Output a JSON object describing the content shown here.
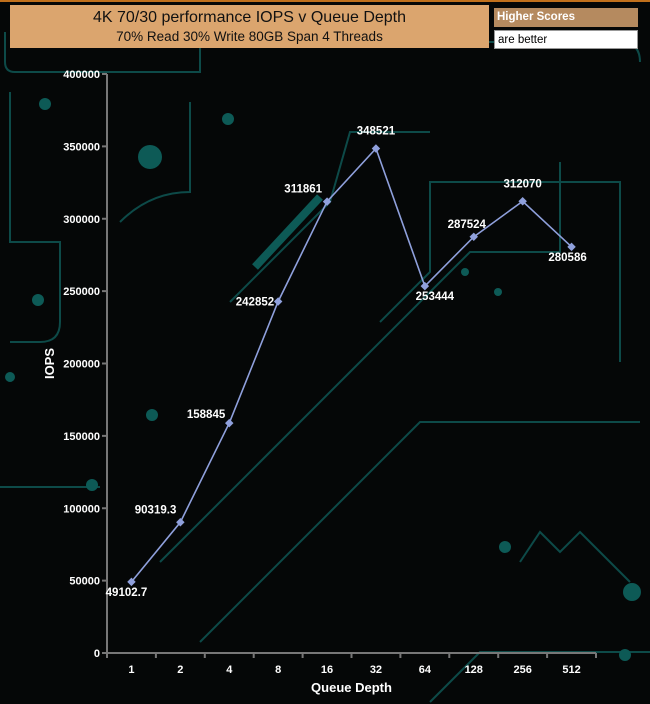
{
  "header": {
    "title": "4K 70/30 performance IOPS v Queue Depth",
    "subtitle": "70% Read 30% Write 80GB Span 4 Threads"
  },
  "note": {
    "line1": "Higher Scores",
    "line2": "are better"
  },
  "chart_data": {
    "type": "line",
    "title": "4K 70/30 performance IOPS v Queue Depth",
    "subtitle": "70% Read 30% Write 80GB Span 4 Threads",
    "xlabel": "Queue Depth",
    "ylabel": "IOPS",
    "categories": [
      "1",
      "2",
      "4",
      "8",
      "16",
      "32",
      "64",
      "128",
      "256",
      "512"
    ],
    "series": [
      {
        "name": "IOPS",
        "color": "#8fa0dc",
        "values": [
          49102.7,
          90319.3,
          158845,
          242852,
          311861,
          348521,
          253444,
          287524,
          312070,
          280586
        ],
        "labels": [
          "49102.7",
          "90319.3",
          "158845",
          "242852",
          "311861",
          "348521",
          "253444",
          "287524",
          "312070",
          "280586"
        ]
      }
    ],
    "ylim": [
      0,
      400000
    ],
    "yticks": [
      "0",
      "50000",
      "100000",
      "150000",
      "200000",
      "250000",
      "300000",
      "350000",
      "400000"
    ],
    "grid": false,
    "legend": "none"
  }
}
